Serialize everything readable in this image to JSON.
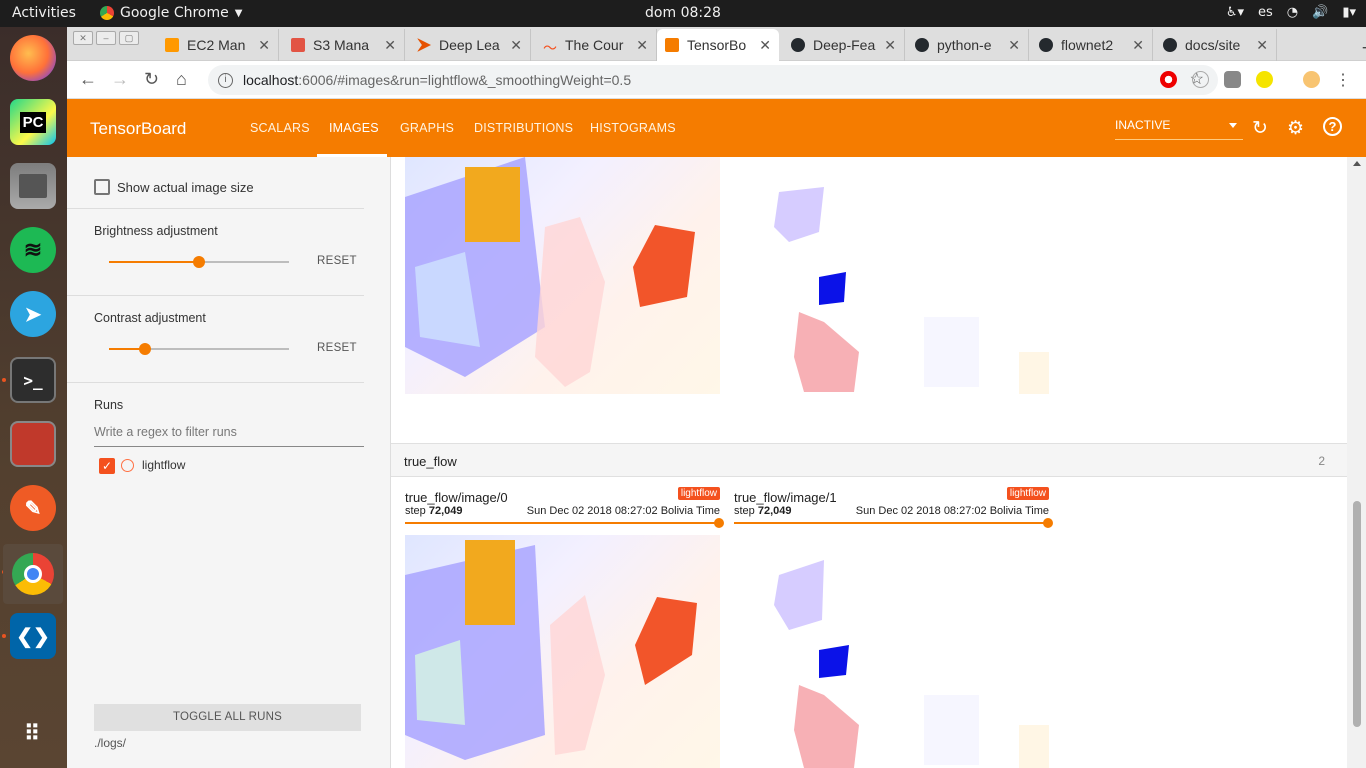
{
  "topbar": {
    "activities": "Activities",
    "app": "Google Chrome",
    "clock": "dom 08:28",
    "lang": "es"
  },
  "tabs": [
    {
      "title": "EC2 Man",
      "color": "#ff9900"
    },
    {
      "title": "S3 Mana",
      "color": "#e25444"
    },
    {
      "title": "Deep Lea",
      "color": "#e65100"
    },
    {
      "title": "The Cour",
      "color": "#f4511e"
    },
    {
      "title": "TensorBo",
      "color": "#f57c00"
    },
    {
      "title": "Deep-Fea",
      "color": "#24292e"
    },
    {
      "title": "python-e",
      "color": "#24292e"
    },
    {
      "title": "flownet2",
      "color": "#24292e"
    },
    {
      "title": "docs/site",
      "color": "#24292e"
    }
  ],
  "address": {
    "host": "localhost",
    "rest": ":6006/#images&run=lightflow&_smoothingWeight=0.5"
  },
  "header": {
    "logo": "TensorBoard",
    "nav": [
      "SCALARS",
      "IMAGES",
      "GRAPHS",
      "DISTRIBUTIONS",
      "HISTOGRAMS"
    ],
    "status": "INACTIVE"
  },
  "sidebar": {
    "show_actual": "Show actual image size",
    "brightness": "Brightness adjustment",
    "brightness_level": 0.5,
    "contrast": "Contrast adjustment",
    "contrast_level": 0.2,
    "reset": "RESET",
    "runs": "Runs",
    "filter_placeholder": "Write a regex to filter runs",
    "run_name": "lightflow",
    "toggle": "TOGGLE ALL RUNS",
    "logdir": "./logs/"
  },
  "group": {
    "name": "true_flow",
    "count": "2"
  },
  "cards": [
    {
      "title": "true_flow/image/0",
      "badge": "lightflow",
      "step_label": "step",
      "step": "72,049",
      "time": "Sun Dec 02 2018 08:27:02 Bolivia Time"
    },
    {
      "title": "true_flow/image/1",
      "badge": "lightflow",
      "step_label": "step",
      "step": "72,049",
      "time": "Sun Dec 02 2018 08:27:02 Bolivia Time"
    }
  ]
}
